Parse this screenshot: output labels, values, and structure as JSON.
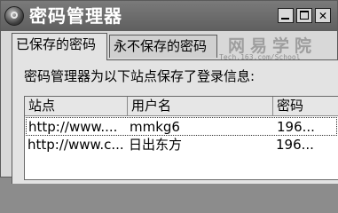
{
  "window": {
    "title": "密码管理器"
  },
  "tabs": [
    {
      "label": "已保存的密码",
      "active": true
    },
    {
      "label": "永不保存的密码",
      "active": false
    }
  ],
  "watermark": {
    "line1": "网易学院",
    "line2": "Tech.163.com/School"
  },
  "info_text": "密码管理器为以下站点保存了登录信息:",
  "table": {
    "columns": [
      "站点",
      "用户名",
      "密码"
    ],
    "rows": [
      [
        "http://www....",
        "mmkg6",
        "196..."
      ],
      [
        "http://www.c...",
        "日出东方",
        "196..."
      ]
    ]
  }
}
